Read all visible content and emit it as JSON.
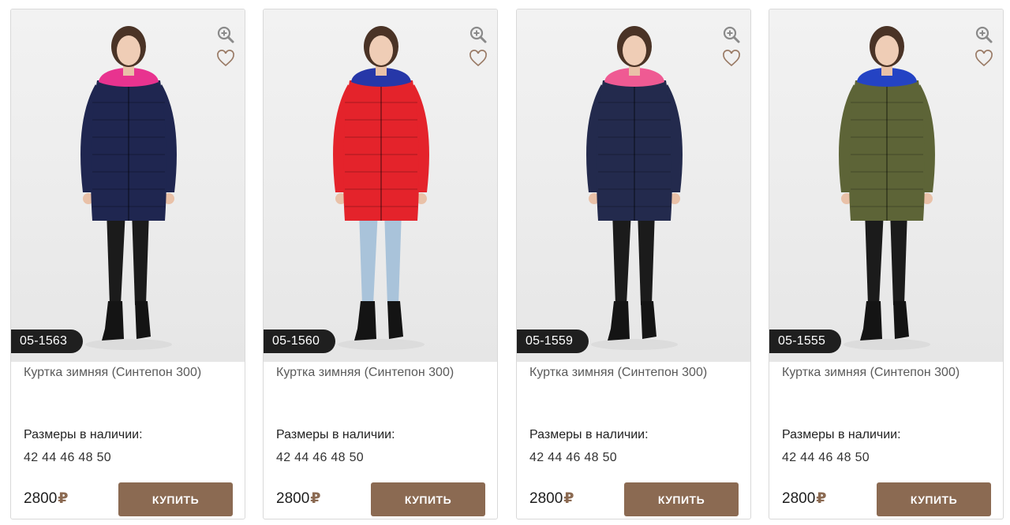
{
  "products": [
    {
      "sku": "05-1563",
      "title": "Куртка зимняя (Синтепон 300)",
      "sizes_label": "Размеры в наличии:",
      "sizes": "42 44 46 48 50",
      "price": "2800",
      "currency": "₽",
      "buy_label": "КУПИТЬ",
      "jacket_color": "#1f2650",
      "hood_color": "#e8338f",
      "pants_color": "#1b1b1b"
    },
    {
      "sku": "05-1560",
      "title": "Куртка зимняя (Синтепон 300)",
      "sizes_label": "Размеры в наличии:",
      "sizes": "42 44 46 48 50",
      "price": "2800",
      "currency": "₽",
      "buy_label": "КУПИТЬ",
      "jacket_color": "#e4232b",
      "hood_color": "#2637a8",
      "pants_color": "#a9c3da"
    },
    {
      "sku": "05-1559",
      "title": "Куртка зимняя (Синтепон 300)",
      "sizes_label": "Размеры в наличии:",
      "sizes": "42 44 46 48 50",
      "price": "2800",
      "currency": "₽",
      "buy_label": "КУПИТЬ",
      "jacket_color": "#232a4d",
      "hood_color": "#ef5a93",
      "pants_color": "#1b1b1b"
    },
    {
      "sku": "05-1555",
      "title": "Куртка зимняя (Синтепон 300)",
      "sizes_label": "Размеры в наличии:",
      "sizes": "42 44 46 48 50",
      "price": "2800",
      "currency": "₽",
      "buy_label": "КУПИТЬ",
      "jacket_color": "#5d6437",
      "hood_color": "#2443c4",
      "pants_color": "#1b1b1b"
    }
  ],
  "icons": {
    "zoom": "zoom-in-icon",
    "favorite": "heart-icon"
  },
  "colors": {
    "accent": "#8b6a52",
    "badge": "#1f1f1f"
  }
}
